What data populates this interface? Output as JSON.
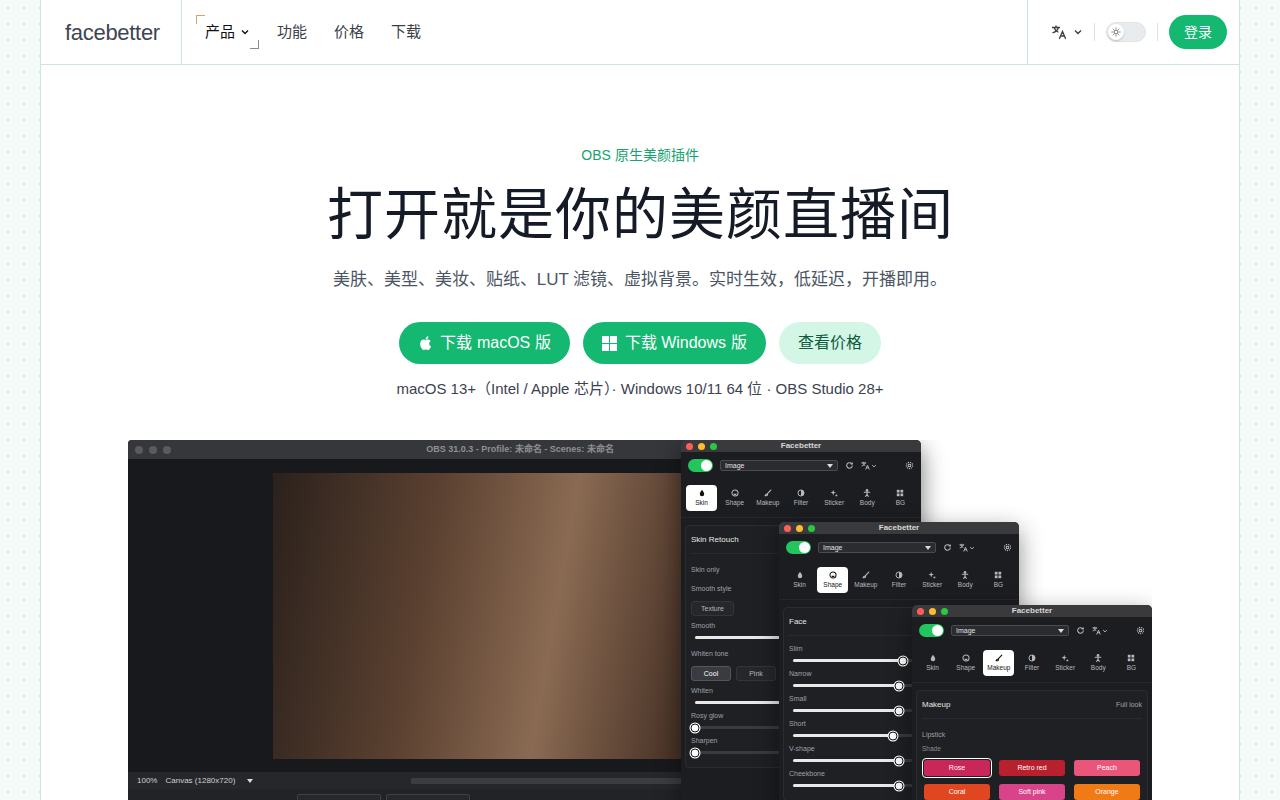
{
  "nav": {
    "logo": "facebetter",
    "items": [
      {
        "label": "产品",
        "selected": true,
        "dropdown": true
      },
      {
        "label": "功能",
        "selected": false,
        "dropdown": false
      },
      {
        "label": "价格",
        "selected": false,
        "dropdown": false
      },
      {
        "label": "下载",
        "selected": false,
        "dropdown": false
      }
    ],
    "theme_toggle": {
      "on": false
    },
    "login": "登录"
  },
  "hero": {
    "eyebrow": "OBS 原生美颜插件",
    "title": "打开就是你的美颜直播间",
    "subtitle": "美肤、美型、美妆、贴纸、LUT 滤镜、虚拟背景。实时生效，低延迟，开播即用。",
    "buttons": [
      {
        "label": "下载 macOS 版",
        "kind": "primary"
      },
      {
        "label": "下载 Windows 版",
        "kind": "primary"
      },
      {
        "label": "查看价格",
        "kind": "soft"
      }
    ],
    "requirements": "macOS 13+（Intel / Apple 芯片）· Windows 10/11 64 位 · OBS Studio 28+"
  },
  "obs": {
    "title": "OBS 31.0.3 - Profile: 未命名 - Scenes: 未命名",
    "zoom": "100%",
    "canvas": "Canvas (1280x720)"
  },
  "panels": [
    {
      "title": "Facebetter",
      "enabled": true,
      "source": "Image",
      "tabs": [
        {
          "label": "Skin",
          "selected": true
        },
        {
          "label": "Shape",
          "selected": false
        },
        {
          "label": "Makeup",
          "selected": false
        },
        {
          "label": "Filter",
          "selected": false
        },
        {
          "label": "Sticker",
          "selected": false
        },
        {
          "label": "Body",
          "selected": false
        },
        {
          "label": "BG",
          "selected": false
        }
      ],
      "heading": "Skin Retouch",
      "rows": [
        {
          "kind": "label",
          "label": "Skin only"
        },
        {
          "kind": "label",
          "label": "Smooth style"
        },
        {
          "kind": "segmented",
          "options": [
            {
              "label": "Texture",
              "selected": false
            }
          ]
        },
        {
          "kind": "slider",
          "label": "Smooth",
          "level": 0.85
        },
        {
          "kind": "label",
          "label": "Whiten tone"
        },
        {
          "kind": "segmented",
          "options": [
            {
              "label": "Cool",
              "selected": true
            },
            {
              "label": "Pink",
              "selected": false
            }
          ]
        },
        {
          "kind": "slider",
          "label": "Whiten",
          "level": 0.8
        },
        {
          "kind": "slider",
          "label": "Rosy glow",
          "level": 0
        },
        {
          "kind": "slider",
          "label": "Sharpen",
          "level": 0
        }
      ]
    },
    {
      "title": "Facebetter",
      "enabled": true,
      "source": "Image",
      "tabs": [
        {
          "label": "Skin",
          "selected": false
        },
        {
          "label": "Shape",
          "selected": true
        },
        {
          "label": "Makeup",
          "selected": false
        },
        {
          "label": "Filter",
          "selected": false
        },
        {
          "label": "Sticker",
          "selected": false
        },
        {
          "label": "Body",
          "selected": false
        },
        {
          "label": "BG",
          "selected": false
        }
      ],
      "heading": "Face",
      "rows": [
        {
          "kind": "slider",
          "label": "Slim",
          "level": 0.52
        },
        {
          "kind": "slider",
          "label": "Narrow",
          "level": 0.5
        },
        {
          "kind": "slider",
          "label": "Small",
          "level": 0.5
        },
        {
          "kind": "slider",
          "label": "Short",
          "level": 0.47
        },
        {
          "kind": "slider",
          "label": "V-shape",
          "level": 0.5
        },
        {
          "kind": "slider",
          "label": "Cheekbone",
          "level": 0.5
        }
      ]
    },
    {
      "title": "Facebetter",
      "enabled": true,
      "source": "Image",
      "tabs": [
        {
          "label": "Skin",
          "selected": false
        },
        {
          "label": "Shape",
          "selected": false
        },
        {
          "label": "Makeup",
          "selected": true
        },
        {
          "label": "Filter",
          "selected": false
        },
        {
          "label": "Sticker",
          "selected": false
        },
        {
          "label": "Body",
          "selected": false
        },
        {
          "label": "BG",
          "selected": false
        }
      ],
      "heading": "Makeup",
      "heading_note": "Full look",
      "rows": [
        {
          "kind": "label",
          "label": "Lipstick"
        },
        {
          "kind": "caption",
          "label": "Shade"
        },
        {
          "kind": "swatches",
          "options": [
            {
              "label": "Rose",
              "selected": true,
              "color": "#c9265a"
            },
            {
              "label": "Retro red",
              "selected": false,
              "color": "#b8202e"
            },
            {
              "label": "Peach",
              "selected": false,
              "color": "#e9567a"
            },
            {
              "label": "Coral",
              "selected": false,
              "color": "#e0461f"
            },
            {
              "label": "Soft pink",
              "selected": false,
              "color": "#d9438a"
            },
            {
              "label": "Orange",
              "selected": false,
              "color": "#f07a16"
            }
          ]
        }
      ]
    }
  ]
}
